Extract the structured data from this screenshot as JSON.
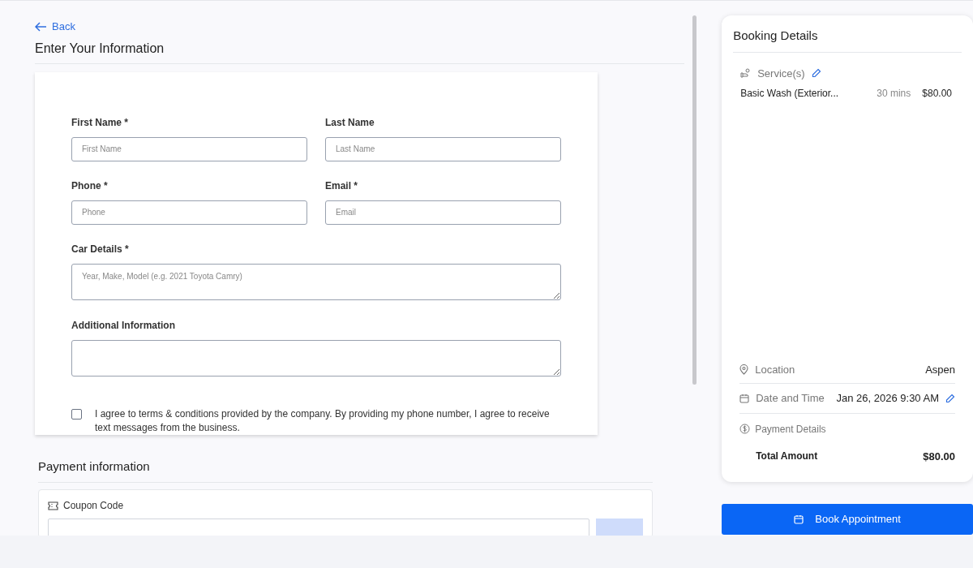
{
  "back_link": {
    "label": "Back"
  },
  "form": {
    "title": "Enter Your Information",
    "fields": [
      {
        "label": "First Name *",
        "placeholder": "First Name",
        "kind": "input"
      },
      {
        "label": "Last Name",
        "placeholder": "Last Name",
        "kind": "input"
      },
      {
        "label": "Phone *",
        "placeholder": "Phone",
        "kind": "input"
      },
      {
        "label": "Email *",
        "placeholder": "Email",
        "kind": "input"
      },
      {
        "label": "Car Details *",
        "placeholder": "Year, Make, Model (e.g. 2021 Toyota Camry)",
        "kind": "textarea"
      },
      {
        "label": "Additional Information",
        "kind": "textarea"
      }
    ],
    "consent": {
      "text": "I agree to terms & conditions provided by the company. By providing my phone number, I agree to receive text messages from the business.",
      "checked": false
    }
  },
  "payment": {
    "title": "Payment information",
    "coupon_label": "Coupon Code"
  },
  "booking": {
    "title": "Booking Details",
    "services_label": "Service(s)",
    "services": [
      {
        "name": "Basic Wash (Exterior...",
        "duration": "30 mins",
        "price": "$80.00"
      }
    ],
    "location_label": "Location",
    "location": "Aspen",
    "datetime_label": "Date and Time",
    "datetime": "Jan 26, 2026 9:30 AM",
    "payment_label": "Payment Details",
    "total_label": "Total Amount",
    "total": "$80.00"
  },
  "book_button": "Book Appointment"
}
